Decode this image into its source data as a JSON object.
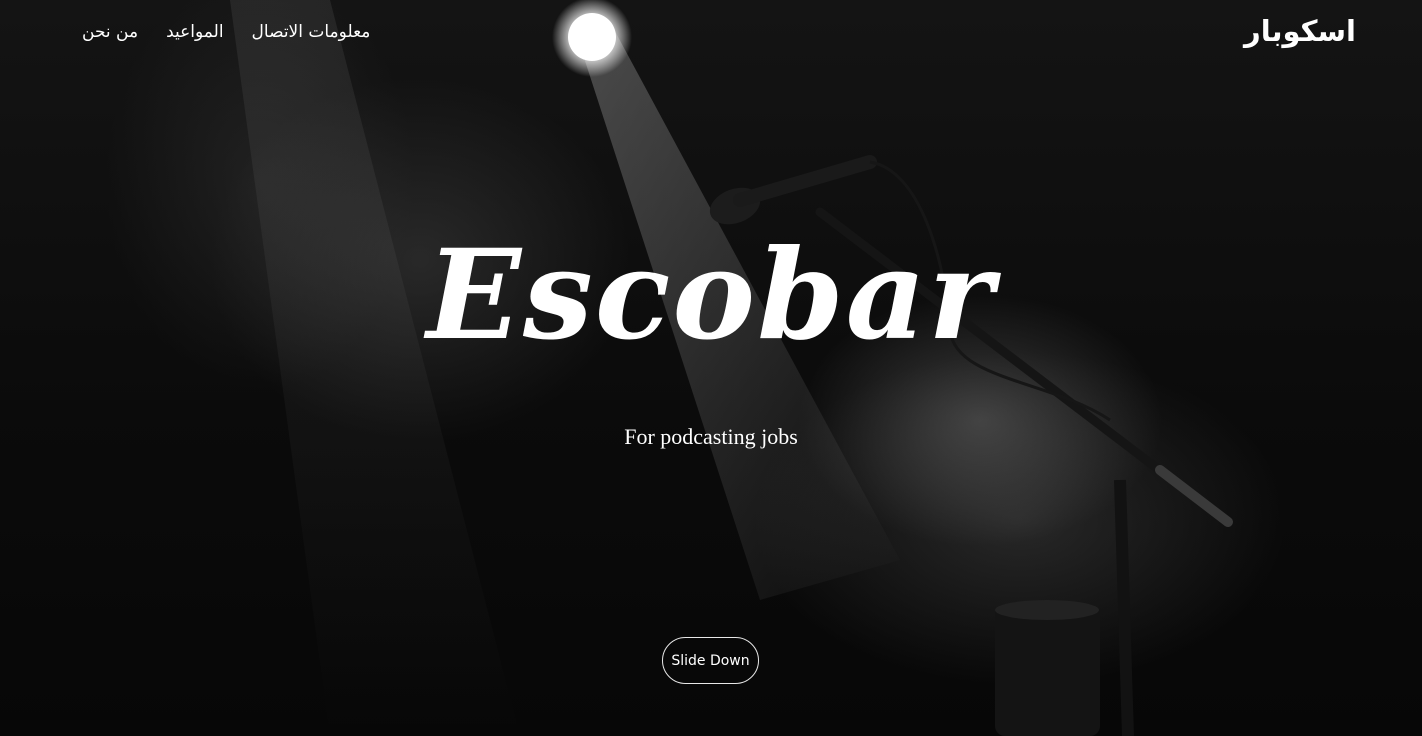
{
  "header": {
    "logo": "اسكوبار",
    "nav": [
      {
        "label": "من نحن"
      },
      {
        "label": "المواعيد"
      },
      {
        "label": "معلومات الاتصال"
      }
    ]
  },
  "hero": {
    "title": "Escobar",
    "subtitle": "For podcasting jobs",
    "button_label": "Slide Down",
    "background_icon": "microphone-stage-photo"
  },
  "colors": {
    "text": "#ffffff",
    "background": "#0d0d0d",
    "button_border": "#e8e8e8"
  }
}
